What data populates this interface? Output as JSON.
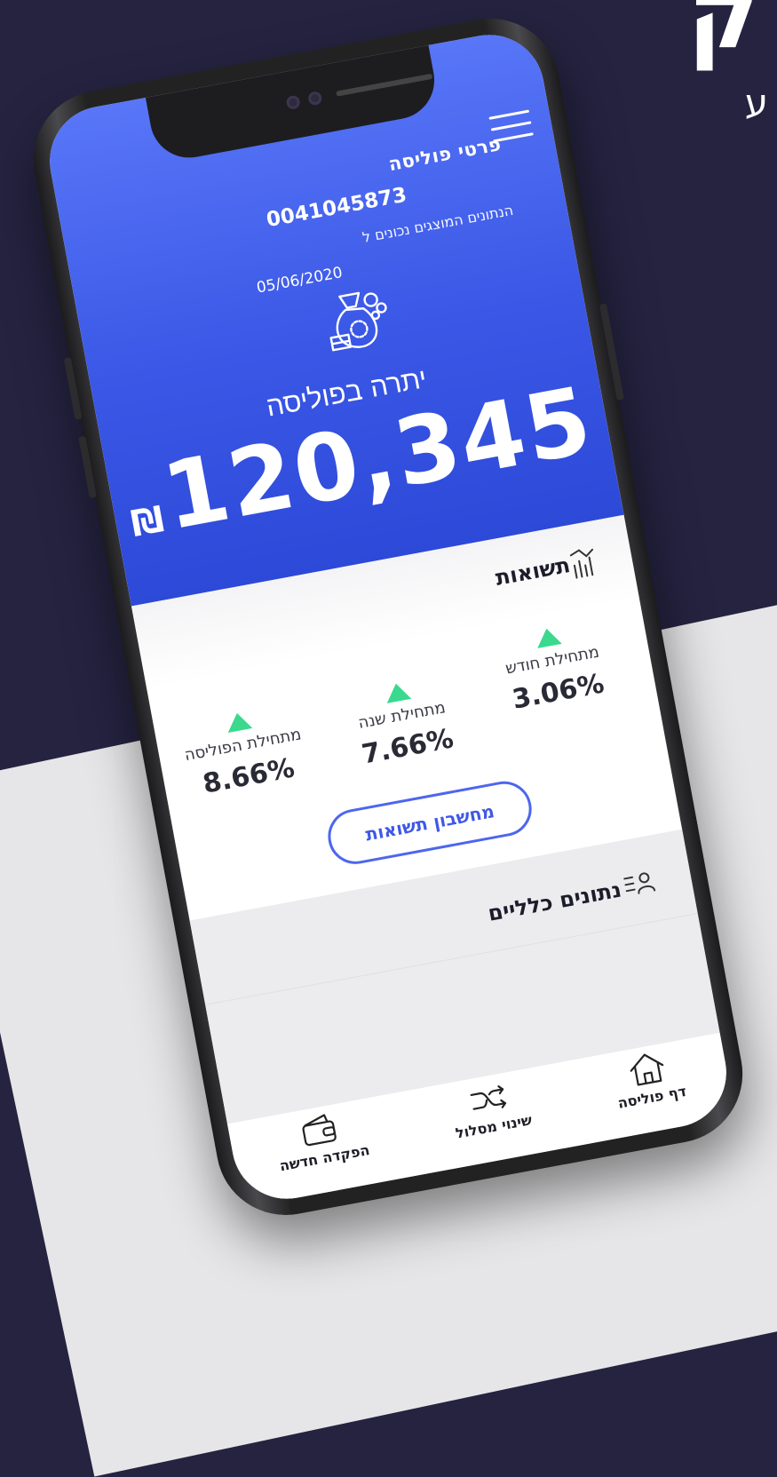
{
  "header": {
    "title": "פרטי פוליסה",
    "policy_number": "0041045873",
    "as_of_text": "הנתונים המוצגים נכונים ל",
    "as_of_date": "05/06/2020"
  },
  "balance": {
    "label": "יתרה בפוליסה",
    "amount": "120,345",
    "currency": "₪"
  },
  "returns": {
    "title": "תשואות",
    "items": [
      {
        "label": "מתחילת חודש",
        "value": "3.06%",
        "trend": "up"
      },
      {
        "label": "מתחילת שנה",
        "value": "7.66%",
        "trend": "up"
      },
      {
        "label": "מתחילת הפוליסה",
        "value": "8.66%",
        "trend": "up"
      }
    ],
    "calc_button": "מחשבון תשואות"
  },
  "general": {
    "title": "נתונים כלליים"
  },
  "nav": [
    {
      "label": "דף פוליסה",
      "icon": "home-icon"
    },
    {
      "label": "שינוי מסלול",
      "icon": "route-change-icon"
    },
    {
      "label": "הפקדה חדשה",
      "icon": "wallet-icon"
    }
  ],
  "colors": {
    "primary": "#3f58e6",
    "positive": "#3ad98e",
    "background": "#252340"
  }
}
